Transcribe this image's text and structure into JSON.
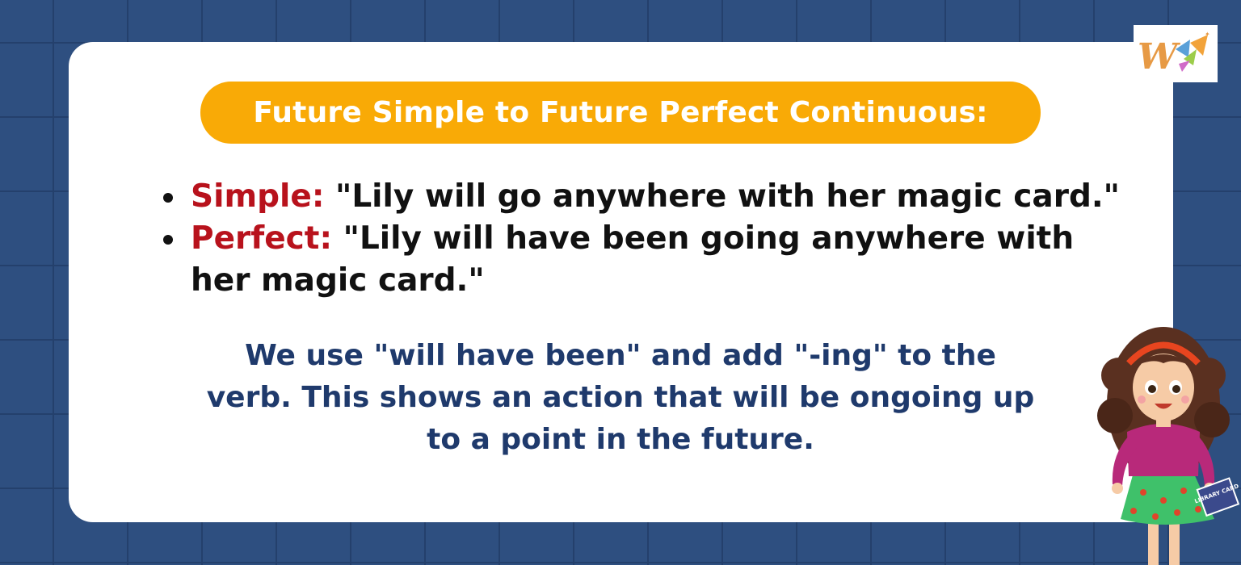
{
  "title": "Future Simple to Future Perfect Continuous:",
  "examples": [
    {
      "label": "Simple:",
      "sentence": "\"Lily will go anywhere with her magic card.\""
    },
    {
      "label": "Perfect:",
      "sentence": "\"Lily will have been going anywhere with her magic card.\""
    }
  ],
  "explanation": "We use \"will have been\" and add \"-ing\" to the verb. This shows an action that will be ongoing up to a point in the future.",
  "card_text": "LIBRARY CARD",
  "logo": {
    "letter": "W"
  },
  "colors": {
    "background": "#2e4f80",
    "grid_lines": "#24406c",
    "card": "#ffffff",
    "title_pill": "#f9aa06",
    "label_red": "#b8121c",
    "explanation_text": "#1f3a6c"
  }
}
